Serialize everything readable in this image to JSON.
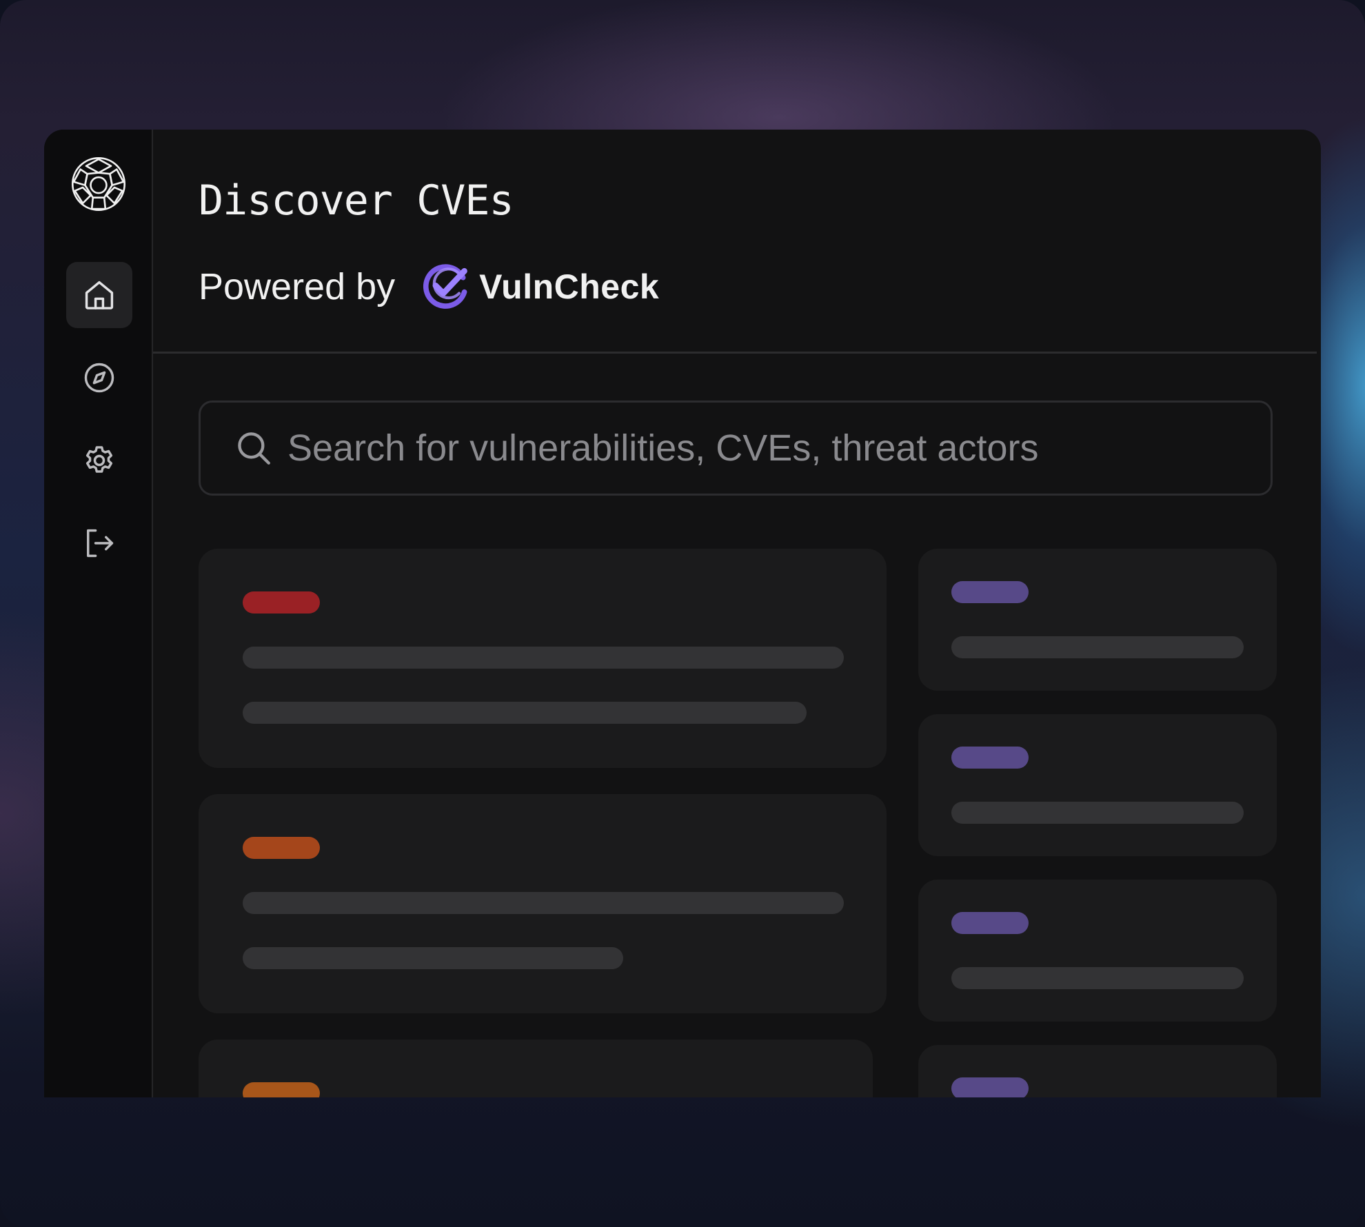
{
  "page": {
    "title": "Discover CVEs",
    "powered_by": "Powered by",
    "brand_name": "VulnCheck"
  },
  "search": {
    "placeholder": "Search for vulnerabilities, CVEs, threat actors"
  },
  "sidebar": {
    "items": [
      {
        "icon": "home-icon",
        "active": true
      },
      {
        "icon": "compass-icon",
        "active": false
      },
      {
        "icon": "gear-icon",
        "active": false
      },
      {
        "icon": "logout-icon",
        "active": false
      }
    ]
  },
  "colors": {
    "severity_critical": "#9a2125",
    "severity_high": "#a5461b",
    "severity_medium": "#a8561a",
    "tag_purple": "#574988",
    "skeleton": "#333335",
    "brand_purple": "#8b6bf0"
  }
}
